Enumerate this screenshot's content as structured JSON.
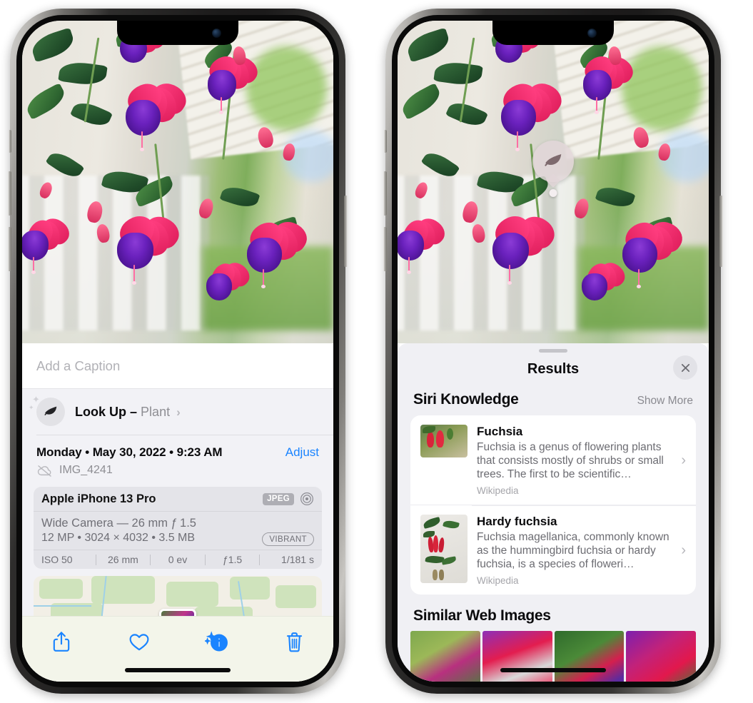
{
  "left_phone": {
    "caption_field": {
      "placeholder": "Add a Caption",
      "value": ""
    },
    "look_up": {
      "label": "Look Up",
      "dash": "–",
      "subject": "Plant",
      "chevron": "›",
      "icon": "leaf-icon"
    },
    "meta": {
      "date_line": "Monday • May 30, 2022 • 9:23 AM",
      "adjust_label": "Adjust",
      "filename": "IMG_4241",
      "cloud_icon": "cloud-slash-icon"
    },
    "camera_card": {
      "device": "Apple iPhone 13 Pro",
      "format_badge": "JPEG",
      "lens_icon": "aperture-icon",
      "lens_line": "Wide Camera — 26 mm ƒ 1.5",
      "specs_line": "12 MP • 3024 × 4032 • 3.5 MB",
      "style_badge": "VIBRANT",
      "exif": [
        "ISO 50",
        "26 mm",
        "0 ev",
        "ƒ1.5",
        "1/181 s"
      ]
    },
    "toolbar": [
      {
        "name": "share-button",
        "icon": "share-icon"
      },
      {
        "name": "favorite-button",
        "icon": "heart-icon"
      },
      {
        "name": "info-button",
        "icon": "info-sparkle-icon"
      },
      {
        "name": "delete-button",
        "icon": "trash-icon"
      }
    ]
  },
  "right_phone": {
    "visual_lookup_badge": {
      "icon": "leaf-icon"
    },
    "sheet": {
      "title": "Results",
      "close_label": "×",
      "siri_knowledge": {
        "heading": "Siri Knowledge",
        "show_more": "Show More",
        "items": [
          {
            "title": "Fuchsia",
            "description": "Fuchsia is a genus of flowering plants that consists mostly of shrubs or small trees. The first to be scientific…",
            "source": "Wikipedia",
            "chevron": "›"
          },
          {
            "title": "Hardy fuchsia",
            "description": "Fuchsia magellanica, commonly known as the hummingbird fuchsia or hardy fuchsia, is a species of floweri…",
            "source": "Wikipedia",
            "chevron": "›"
          }
        ]
      },
      "similar_web_images": {
        "heading": "Similar Web Images",
        "tiles": [
          "fuchsia-thumb-1",
          "fuchsia-thumb-2",
          "fuchsia-thumb-3",
          "fuchsia-thumb-4"
        ]
      }
    }
  },
  "colors": {
    "accent_blue": "#1a84ff",
    "sheet_bg": "#f2f2f6",
    "results_bg": "#f0f0f4",
    "card_bg": "#ffffff",
    "secondary_text": "#8e8e93",
    "toolbar_bg": "#f3f5ea"
  }
}
